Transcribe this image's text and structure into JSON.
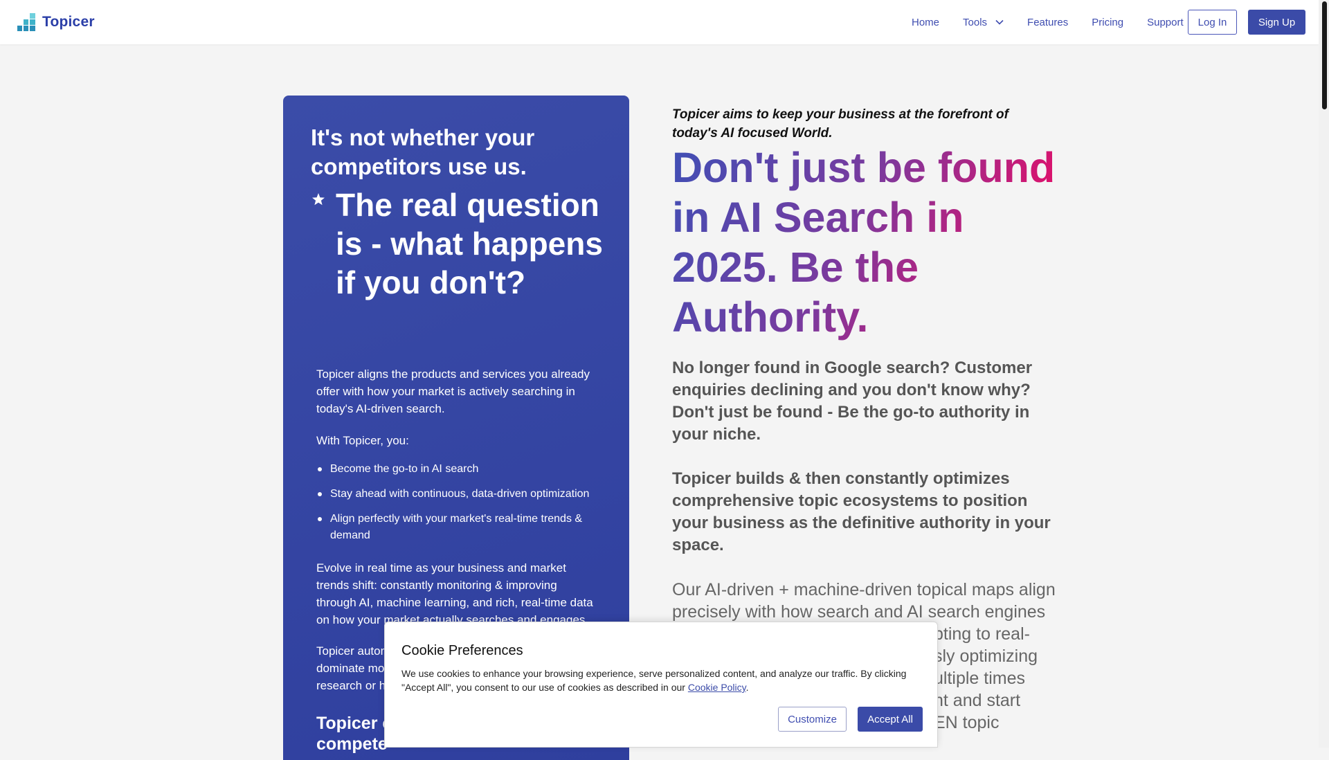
{
  "header": {
    "brand_name": "Topicer",
    "logo_icon": "bar-steps-logo",
    "nav": [
      {
        "label": "Home"
      },
      {
        "label": "Tools",
        "icon": "chevron-down-icon"
      },
      {
        "label": "Features"
      },
      {
        "label": "Pricing"
      },
      {
        "label": "Support"
      }
    ],
    "login_label": "Log In",
    "signup_label": "Sign Up"
  },
  "card": {
    "heading": "It's not whether your competitors use us.",
    "star_icon": "star-icon",
    "question": "The real question is - what happens if you don't?",
    "intro": "Topicer aligns the products and services you already offer with how your market is actively searching in today's AI-driven search.",
    "with_label": "With Topicer, you:",
    "benefits": [
      "Become the go-to in AI search",
      "Stay ahead with continuous, data-driven optimization",
      "Align perfectly with your market's real-time trends & demand"
    ],
    "evolve": "Evolve in real time as your business and market trends shift: constantly monitoring & improving through AI, machine learning, and rich, real-time data on how your market actually searches and engages.",
    "automates_partial": "Topicer autom",
    "dominate_partial": "dominate mo",
    "research_partial": "research or h",
    "closing_partial": "Topicer c",
    "closing_partial_2": "compete"
  },
  "hero": {
    "tagline": "Topicer aims to keep your business at the forefront of today's AI focused World.",
    "headline": "Don't just be found in AI Search in 2025. Be the Authority.",
    "lead_1": "No longer found in Google search? Customer enquiries declining and you don't know why? Don't just be found - Be the go-to authority in your niche.",
    "lead_2": "Topicer builds & then constantly optimizes comprehensive topic ecosystems to position your business as the definitive authority in your space.",
    "body_line_1": "Our AI-driven + machine-driven topical maps align",
    "body_line_2": "precisely with how search and AI search engines",
    "body_line_3": "pting to real-",
    "body_line_4": "sly optimizing",
    "body_line_5": "ultiple times",
    "body_line_6": "nt and start",
    "body_line_7": "EN topic"
  },
  "cookie": {
    "title": "Cookie Preferences",
    "text": "We use cookies to enhance your browsing experience, serve personalized content, and analyze our traffic. By clicking \"Accept All\", you consent to our use of cookies as described in our ",
    "link": "Cookie Policy",
    "text_end": ".",
    "customize_label": "Customize",
    "accept_label": "Accept All"
  },
  "colors": {
    "brand": "#2b3fa8",
    "card_bg": "#3b4ca8",
    "hero_gradient_start": "#3f4fb5",
    "hero_gradient_end": "#e0106a",
    "page_bg": "#f4f4f4"
  }
}
